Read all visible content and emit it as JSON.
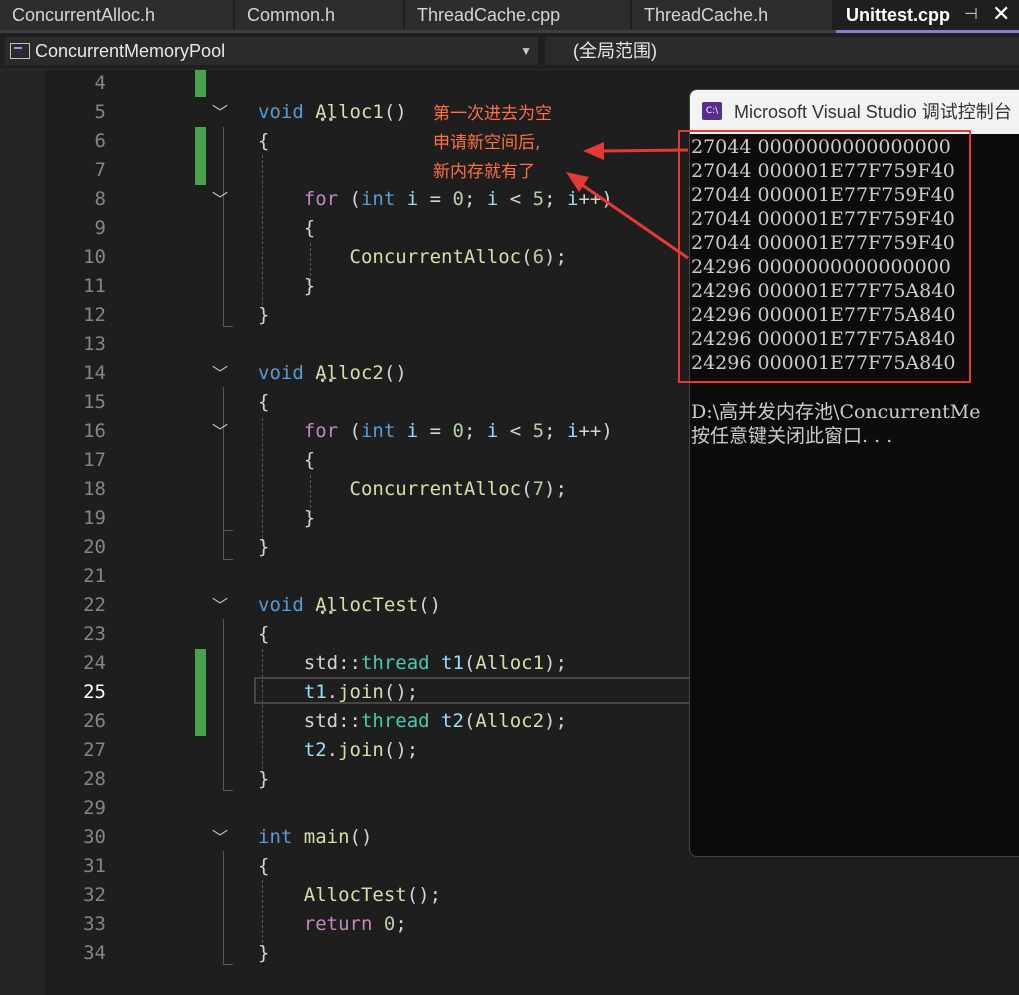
{
  "tabs": [
    {
      "label": "ConcurrentAlloc.h",
      "active": false
    },
    {
      "label": "Common.h",
      "active": false
    },
    {
      "label": "ThreadCache.cpp",
      "active": false
    },
    {
      "label": "ThreadCache.h",
      "active": false
    },
    {
      "label": "Unittest.cpp",
      "active": true
    }
  ],
  "tab_actions": {
    "pin": "⊣",
    "close": "✕"
  },
  "navbar": {
    "project": "ConcurrentMemoryPool",
    "scope": "(全局范围)"
  },
  "editor": {
    "current_line": 25,
    "lines": [
      {
        "n": "4"
      },
      {
        "n": "5"
      },
      {
        "n": "6"
      },
      {
        "n": "7"
      },
      {
        "n": "8"
      },
      {
        "n": "9"
      },
      {
        "n": "10"
      },
      {
        "n": "11"
      },
      {
        "n": "12"
      },
      {
        "n": "13"
      },
      {
        "n": "14"
      },
      {
        "n": "15"
      },
      {
        "n": "16"
      },
      {
        "n": "17"
      },
      {
        "n": "18"
      },
      {
        "n": "19"
      },
      {
        "n": "20"
      },
      {
        "n": "21"
      },
      {
        "n": "22"
      },
      {
        "n": "23"
      },
      {
        "n": "24"
      },
      {
        "n": "25"
      },
      {
        "n": "26"
      },
      {
        "n": "27"
      },
      {
        "n": "28"
      },
      {
        "n": "29"
      },
      {
        "n": "30"
      },
      {
        "n": "31"
      },
      {
        "n": "32"
      },
      {
        "n": "33"
      },
      {
        "n": "34"
      }
    ]
  },
  "console": {
    "title": "Microsoft Visual Studio 调试控制台",
    "icon": "C:\\",
    "output": [
      "27044 0000000000000000",
      "27044 000001E77F759F40",
      "27044 000001E77F759F40",
      "27044 000001E77F759F40",
      "27044 000001E77F759F40",
      "24296 0000000000000000",
      "24296 000001E77F75A840",
      "24296 000001E77F75A840",
      "24296 000001E77F75A840",
      "24296 000001E77F75A840"
    ],
    "path_line": "D:\\高并发内存池\\ConcurrentMe",
    "press_key": "按任意键关闭此窗口. . ."
  },
  "annotation": {
    "line1": "第一次进去为空",
    "line2": "申请新空间后,",
    "line3": "新内存就有了",
    "color": "#e53935"
  }
}
